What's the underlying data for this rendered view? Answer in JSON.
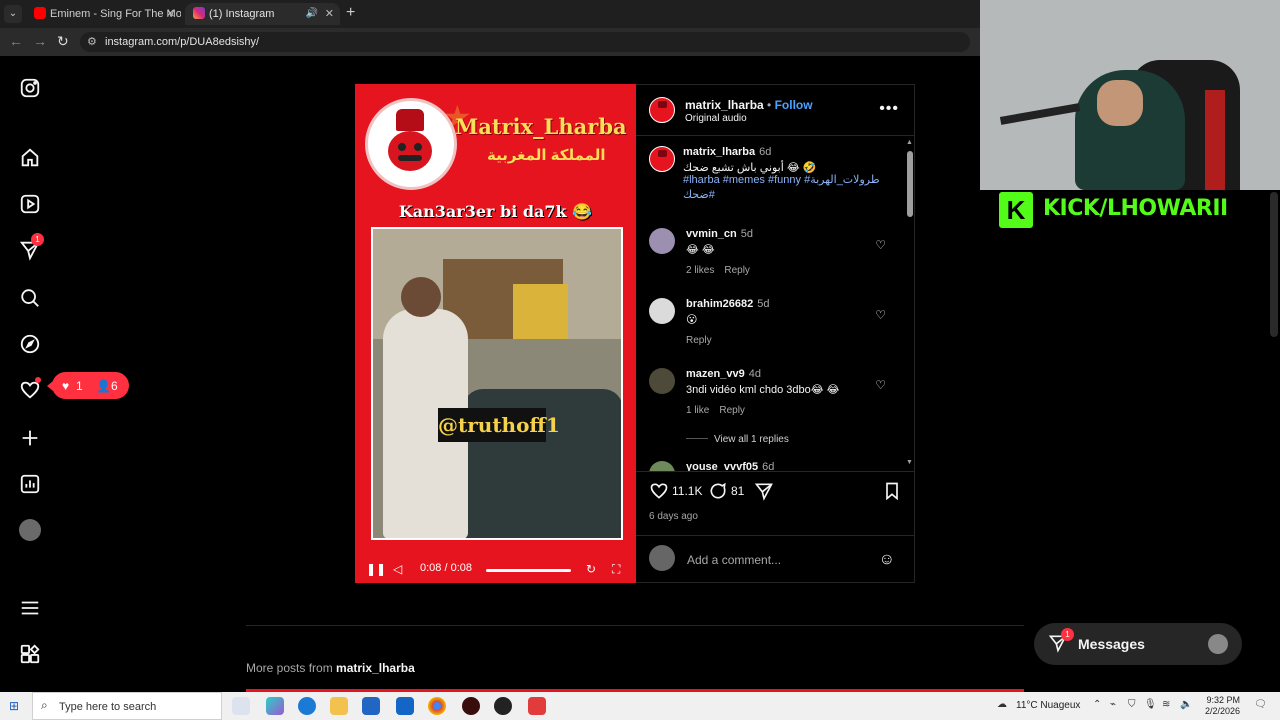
{
  "browser": {
    "tabs": [
      {
        "title": "Eminem - Sing For The Moment",
        "active": false
      },
      {
        "title": "(1) Instagram",
        "active": true
      }
    ],
    "url": "instagram.com/p/DUA8edsishy/"
  },
  "sidebar": {
    "messages_badge": "1",
    "notifications_popup": {
      "likes": "1",
      "follows": "6"
    }
  },
  "post": {
    "media": {
      "brand_name": "Matrix_Lharba",
      "brand_subtitle": "المملكة المغربية",
      "caption": "Kan3ar3er bi da7k 😂",
      "watermark": "@truthoff1",
      "time": "0:08 / 0:08"
    },
    "header": {
      "username": "matrix_lharba",
      "separator": "•",
      "follow_label": "Follow",
      "audio": "Original audio"
    },
    "caption": {
      "username": "matrix_lharba",
      "time": "6d",
      "text": "أبوني باش تشبع ضحك 😂 🤣",
      "tags": "#lharba #memes #funny #طرولات_الهربة #ضحك"
    },
    "comments": [
      {
        "username": "vvmin_cn",
        "time": "5d",
        "text": "😂 😂",
        "likes": "2 likes",
        "reply": "Reply"
      },
      {
        "username": "brahim26682",
        "time": "5d",
        "text": "😮",
        "likes": "",
        "reply": "Reply"
      },
      {
        "username": "mazen_vv9",
        "time": "4d",
        "text": "3ndi vidéo kml chdo 3dbo😂 😂",
        "likes": "1 like",
        "reply": "Reply",
        "view_replies": "View all 1 replies"
      },
      {
        "username": "youse_vvvf05",
        "time": "6d",
        "text": "",
        "likes": "",
        "reply": ""
      }
    ],
    "actions": {
      "likes": "11.1K",
      "comments": "81"
    },
    "ago": "6 days ago",
    "add_comment_placeholder": "Add a comment..."
  },
  "more_posts": {
    "prefix": "More posts from",
    "username": "matrix_lharba"
  },
  "messages": {
    "label": "Messages",
    "badge": "1"
  },
  "overlay": {
    "kick_text": "KICK/LHOWARII",
    "kick_logo": "K"
  },
  "taskbar": {
    "search_placeholder": "Type here to search",
    "weather": "11°C  Nuageux",
    "time": "9:32 PM",
    "date": "2/2/2026"
  }
}
